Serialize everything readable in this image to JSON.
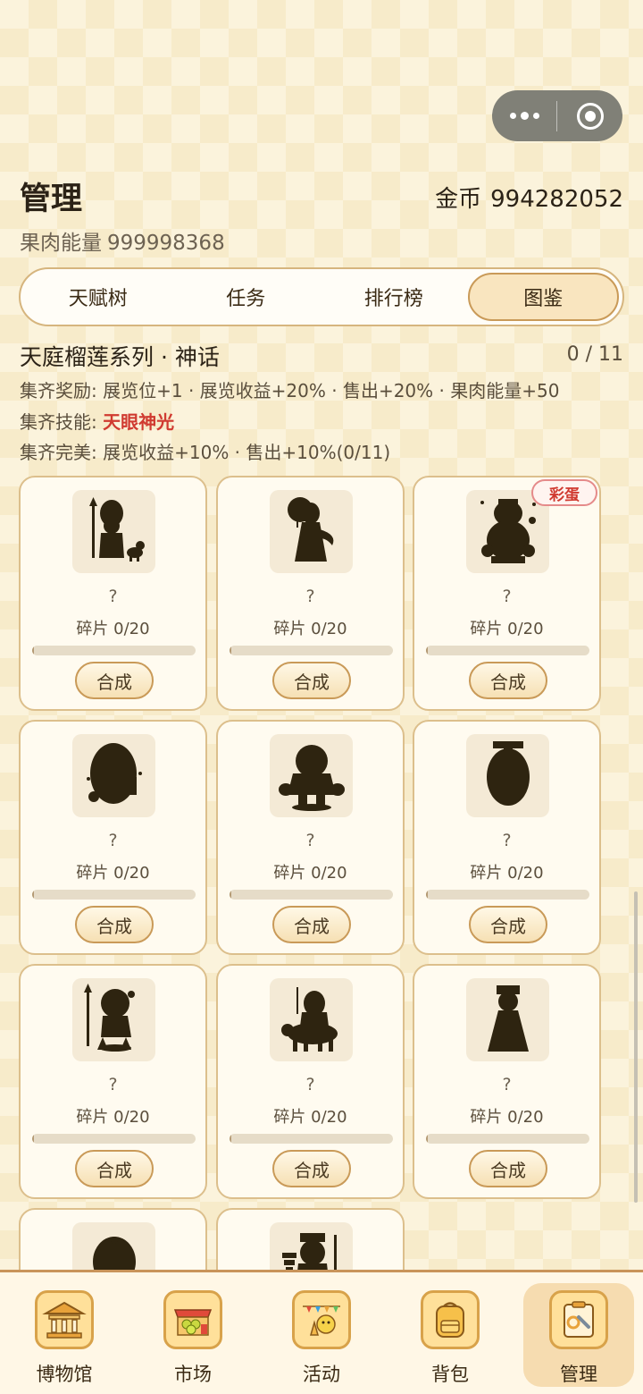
{
  "header": {
    "title": "管理",
    "coins_label": "金币",
    "coins_value": "994282052",
    "energy_label": "果肉能量",
    "energy_value": "999998368"
  },
  "tabs": [
    {
      "label": "天赋树",
      "active": false
    },
    {
      "label": "任务",
      "active": false
    },
    {
      "label": "排行榜",
      "active": false
    },
    {
      "label": "图鉴",
      "active": true
    }
  ],
  "series": {
    "title": "天庭榴莲系列 · 神话",
    "count": "0 / 11",
    "reward_label": "集齐奖励:",
    "reward_text": "展览位+1 · 展览收益+20% · 售出+20% · 果肉能量+50",
    "skill_label": "集齐技能:",
    "skill_text": "天眼神光",
    "perfect_label": "集齐完美:",
    "perfect_text": "展览收益+10% · 售出+10%(0/11)"
  },
  "cards": [
    {
      "name": "?",
      "fragments": "碎片 0/20",
      "progress": 0,
      "button": "合成",
      "badge": null,
      "figure": "warrior-dog-silhouette"
    },
    {
      "name": "?",
      "fragments": "碎片 0/20",
      "progress": 0,
      "button": "合成",
      "badge": null,
      "figure": "goddess-silhouette"
    },
    {
      "name": "?",
      "fragments": "碎片 0/20",
      "progress": 0,
      "button": "合成",
      "badge": "彩蛋",
      "figure": "wealth-god-silhouette"
    },
    {
      "name": "?",
      "fragments": "碎片 0/20",
      "progress": 0,
      "button": "合成",
      "badge": null,
      "figure": "elder-sage-silhouette"
    },
    {
      "name": "?",
      "fragments": "碎片 0/20",
      "progress": 0,
      "button": "合成",
      "badge": null,
      "figure": "strongman-silhouette"
    },
    {
      "name": "?",
      "fragments": "碎片 0/20",
      "progress": 0,
      "button": "合成",
      "badge": null,
      "figure": "official-silhouette"
    },
    {
      "name": "?",
      "fragments": "碎片 0/20",
      "progress": 0,
      "button": "合成",
      "badge": null,
      "figure": "spear-child-silhouette"
    },
    {
      "name": "?",
      "fragments": "碎片 0/20",
      "progress": 0,
      "button": "合成",
      "badge": null,
      "figure": "ox-rider-silhouette"
    },
    {
      "name": "?",
      "fragments": "碎片 0/20",
      "progress": 0,
      "button": "合成",
      "badge": null,
      "figure": "queen-silhouette"
    },
    {
      "name": "",
      "fragments": "",
      "progress": 0,
      "button": "",
      "badge": null,
      "figure": "monkey-silhouette"
    },
    {
      "name": "",
      "fragments": "",
      "progress": 0,
      "button": "",
      "badge": null,
      "figure": "pagoda-king-silhouette"
    }
  ],
  "bottom_nav": [
    {
      "label": "博物馆",
      "icon": "museum-icon",
      "active": false
    },
    {
      "label": "市场",
      "icon": "market-icon",
      "active": false
    },
    {
      "label": "活动",
      "icon": "event-icon",
      "active": false
    },
    {
      "label": "背包",
      "icon": "backpack-icon",
      "active": false
    },
    {
      "label": "管理",
      "icon": "manage-icon",
      "active": true
    }
  ],
  "colors": {
    "accent_border": "#c99a58",
    "skill_red": "#d03a30",
    "silhouette": "#2e2410",
    "badge_red": "#d03a30"
  }
}
